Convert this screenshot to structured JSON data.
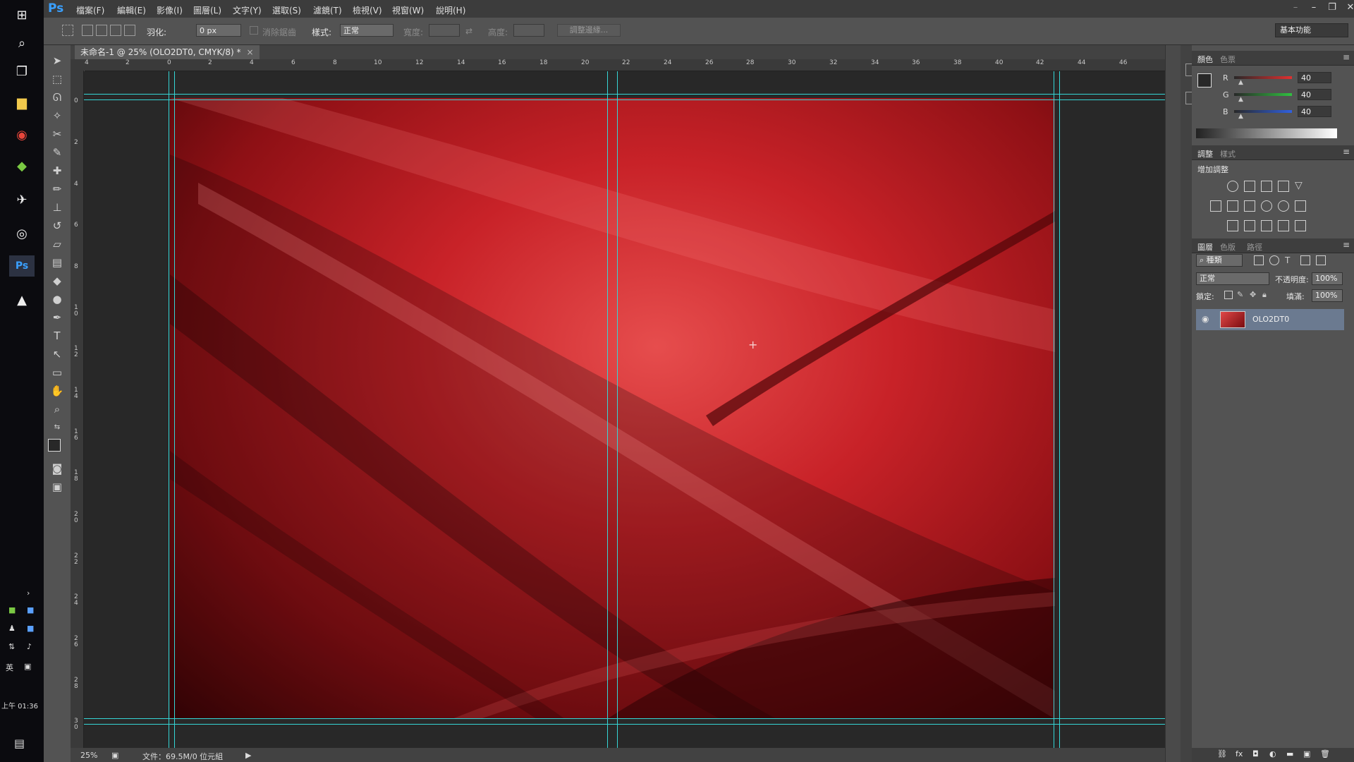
{
  "app": {
    "logo": "Ps"
  },
  "menu": [
    "檔案(F)",
    "編輯(E)",
    "影像(I)",
    "圖層(L)",
    "文字(Y)",
    "選取(S)",
    "濾鏡(T)",
    "檢視(V)",
    "視窗(W)",
    "說明(H)"
  ],
  "window_buttons": {
    "minimize": "–",
    "restore": "❐",
    "close": "✕"
  },
  "options_bar": {
    "feather_label": "羽化:",
    "feather_value": "0 px",
    "antialias_label": "消除鋸齒",
    "style_label": "樣式:",
    "style_value": "正常",
    "width_label": "寬度:",
    "swap_icon": "⇄",
    "height_label": "高度:",
    "refine_edge_button": "調整邊緣...",
    "workspace": "基本功能"
  },
  "document": {
    "tab_title": "未命名-1 @ 25% (OLO2DT0, CMYK/8) *",
    "tab_close": "×",
    "ruler_top": [
      "4",
      "2",
      "0",
      "2",
      "4",
      "6",
      "8",
      "10",
      "12",
      "14",
      "16",
      "18",
      "20",
      "22",
      "24",
      "26",
      "28",
      "30",
      "32",
      "34",
      "36",
      "38",
      "40",
      "42",
      "44",
      "46"
    ],
    "ruler_left": [
      "0",
      "2",
      "4",
      "6",
      "8",
      "1 0",
      "1 2",
      "1 4",
      "1 6",
      "1 8",
      "2 0",
      "2 2",
      "2 4",
      "2 6",
      "2 8",
      "3 0"
    ]
  },
  "status": {
    "zoom": "25%",
    "doc_size": "文件：69.5M/0 位元組"
  },
  "color_panel": {
    "tabs": [
      "顏色",
      "色票"
    ],
    "channels": [
      {
        "label": "R",
        "value": "40",
        "color": "#e03030"
      },
      {
        "label": "G",
        "value": "40",
        "color": "#30c040"
      },
      {
        "label": "B",
        "value": "40",
        "color": "#3060e0"
      }
    ]
  },
  "adjust_panel": {
    "tabs": [
      "調整",
      "樣式"
    ],
    "heading": "增加調整"
  },
  "layers_panel": {
    "tabs": [
      "圖層",
      "色版",
      "路徑"
    ],
    "filter_kind": "種類",
    "blend_mode": "正常",
    "opacity_label": "不透明度:",
    "opacity_value": "100%",
    "lock_label": "鎖定:",
    "fill_label": "填滿:",
    "fill_value": "100%",
    "layer_name": "OLO2DT0"
  },
  "taskbar": {
    "clock": "上午 01:36",
    "ime": "英"
  }
}
